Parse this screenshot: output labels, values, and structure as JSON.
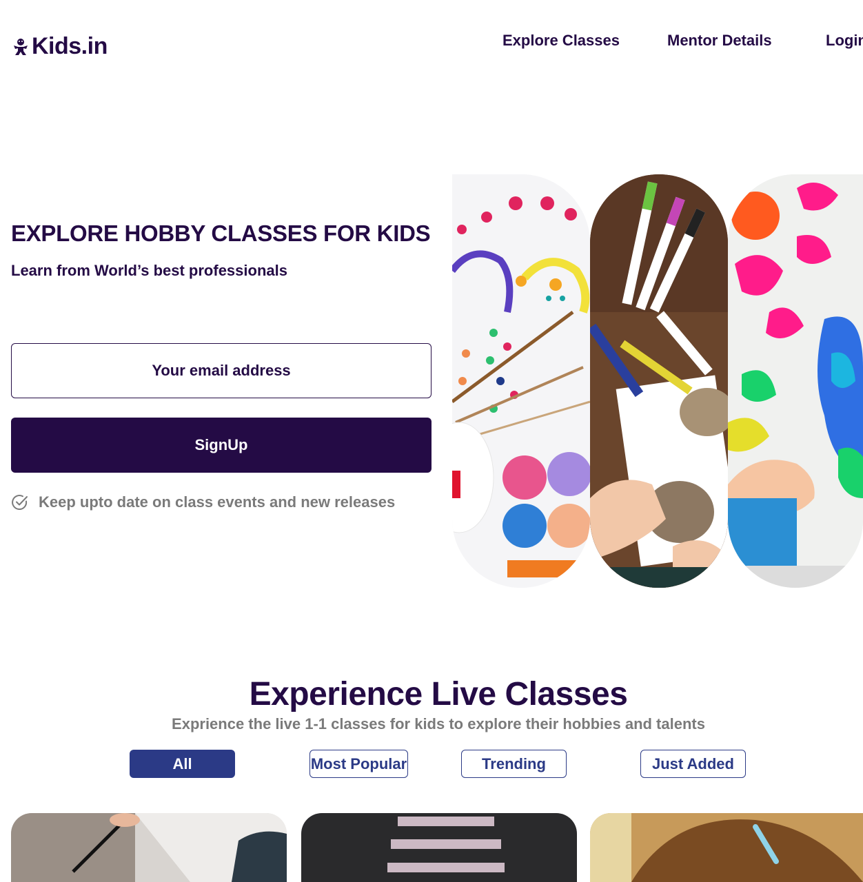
{
  "header": {
    "logo_text": "Kids.in",
    "nav": [
      {
        "label": "Explore Classes"
      },
      {
        "label": "Mentor Details"
      },
      {
        "label": "Login"
      }
    ]
  },
  "hero": {
    "title": "EXPLORE HOBBY CLASSES FOR KIDS",
    "subtitle": "Learn from World’s best professionals",
    "email_placeholder": "Your email address",
    "signup_label": "SignUp",
    "keep_updated": "Keep upto date on class events and new releases"
  },
  "live_classes": {
    "title": "Experience Live Classes",
    "subtitle": "Exprience the live 1-1 classes for kids to explore their hobbies and talents",
    "tabs": [
      {
        "label": "All",
        "active": true
      },
      {
        "label": "Most Popular"
      },
      {
        "label": "Trending"
      },
      {
        "label": "Just Added"
      }
    ]
  },
  "colors": {
    "brand": "#240b45",
    "tab_accent": "#2b3a86",
    "muted_text": "#7a7a7a"
  },
  "icons": [
    "kid-logo-icon",
    "check-circle-icon"
  ]
}
